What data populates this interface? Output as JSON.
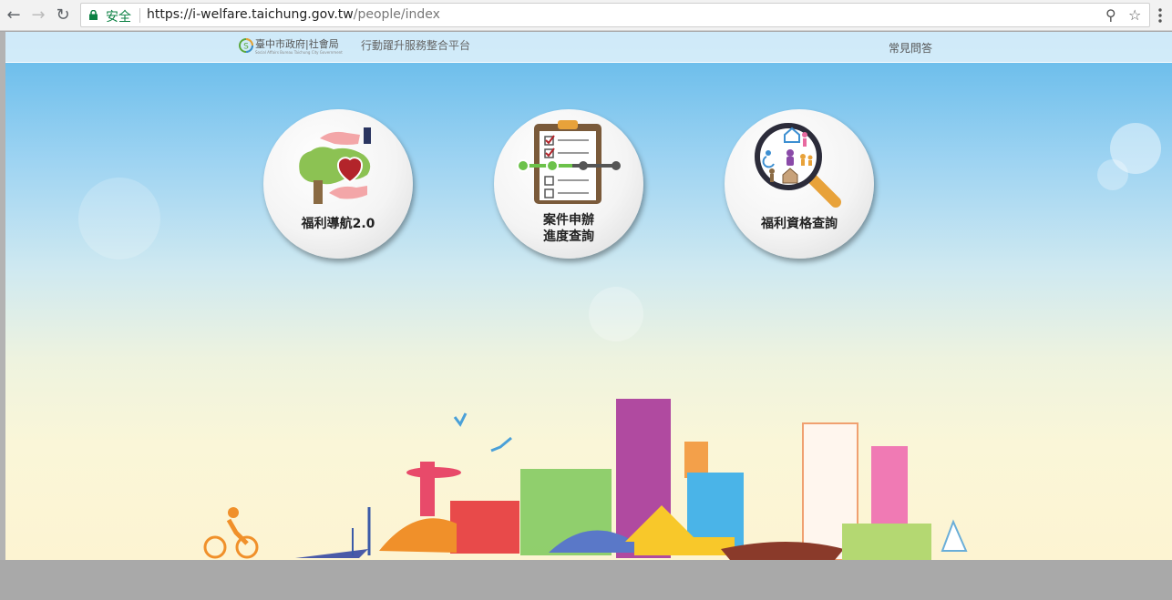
{
  "browser": {
    "secure_label": "安全",
    "url_host": "https://i-welfare.taichung.gov.tw",
    "url_path": "/people/index"
  },
  "header": {
    "org_name": "臺中市政府|社會局",
    "org_subtitle": "Social Affairs Bureau Taichung City Government",
    "platform_name": "行動躍升服務整合平台",
    "faq_link": "常見問答"
  },
  "services": [
    {
      "label": "福利導航2.0"
    },
    {
      "label_line1": "案件申辦",
      "label_line2": "進度查詢"
    },
    {
      "label": "福利資格查詢"
    }
  ],
  "colors": {
    "secure_green": "#0b8043",
    "sky_top": "#5fb8ea",
    "sky_bottom": "#fdf4d2"
  }
}
